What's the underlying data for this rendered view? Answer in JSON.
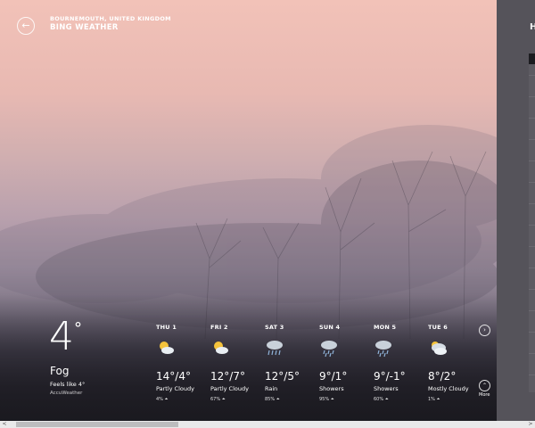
{
  "header": {
    "location": "BOURNEMOUTH, UNITED KINGDOM",
    "app_title": "BING WEATHER"
  },
  "current": {
    "temp": "4",
    "unit": "°",
    "condition": "Fog",
    "feels_like": "Feels like 4°",
    "provider": "AccuWeather"
  },
  "forecast": [
    {
      "day": "THU 1",
      "icon": "partly-cloudy-icon",
      "temps": "14°/4°",
      "condition": "Partly Cloudy",
      "precip": "4% ⏶"
    },
    {
      "day": "FRI 2",
      "icon": "partly-cloudy-icon",
      "temps": "12°/7°",
      "condition": "Partly Cloudy",
      "precip": "67% ⏶"
    },
    {
      "day": "SAT 3",
      "icon": "rain-icon",
      "temps": "12°/5°",
      "condition": "Rain",
      "precip": "85% ⏶"
    },
    {
      "day": "SUN 4",
      "icon": "showers-icon",
      "temps": "9°/1°",
      "condition": "Showers",
      "precip": "95% ⏶"
    },
    {
      "day": "MON 5",
      "icon": "showers-icon",
      "temps": "9°/-1°",
      "condition": "Showers",
      "precip": "60% ⏶"
    },
    {
      "day": "TUE 6",
      "icon": "mostly-cloudy-icon",
      "temps": "8°/2°",
      "condition": "Mostly Cloudy",
      "precip": "1% ⏶"
    }
  ],
  "nav": {
    "next_glyph": "›",
    "more_glyph": "⌃",
    "more_label": "More",
    "back_glyph": "←"
  },
  "side_panel": {
    "heading": "H"
  },
  "scrollbar": {
    "left": "<",
    "right": ">"
  },
  "colors": {
    "sky_top": "#f2c2b8",
    "fog_mid": "#9d8f9f",
    "ground": "#222127",
    "panel": "#55535a"
  }
}
